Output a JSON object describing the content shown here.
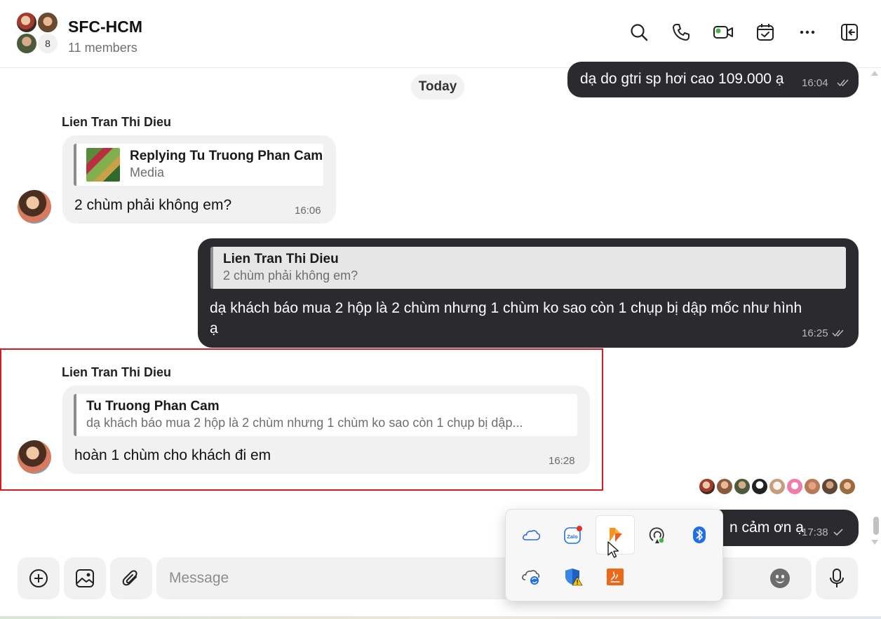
{
  "header": {
    "title": "SFC-HCM",
    "subtitle": "11 members",
    "avatar_count": "8"
  },
  "chat": {
    "date_divider": "Today",
    "messages": [
      {
        "text": "dạ do gtri sp hơi cao 109.000 ạ",
        "time": "16:04"
      },
      {
        "sender": "Lien Tran Thi Dieu",
        "reply_name": "Replying Tu Truong Phan Cam",
        "reply_sub": "Media",
        "text": "2 chùm phải không em?",
        "time": "16:06"
      },
      {
        "reply_name": "Lien Tran Thi Dieu",
        "reply_sub": "2 chùm phải không em?",
        "text_line1": "dạ khách báo mua 2 hộp là 2 chùm nhưng 1 chùm ko sao còn 1 chụp bị dập mốc như hình",
        "text_line2": "ạ",
        "time": "16:25"
      },
      {
        "sender": "Lien Tran Thi Dieu",
        "reply_name": "Tu Truong Phan Cam",
        "reply_sub": "dạ khách báo mua 2 hộp là 2 chùm nhưng 1 chùm ko sao còn 1 chụp bị dập...",
        "text": "hoàn 1 chùm cho khách đi em",
        "time": "16:28"
      },
      {
        "text_partial": "n cảm ơn ạ",
        "time": "17:38"
      }
    ]
  },
  "composer": {
    "placeholder": "Message"
  },
  "tray": {
    "icons": [
      "onedrive-icon",
      "zalo-icon",
      "app-orange-icon",
      "airplay-icon",
      "bluetooth-icon",
      "onedrive-sync-icon",
      "windows-security-icon",
      "java-update-icon"
    ]
  },
  "colors": {
    "outgoing_bubble": "#2b2b2f",
    "incoming_bubble": "#f1f1f1",
    "highlight_border": "#d71920"
  }
}
